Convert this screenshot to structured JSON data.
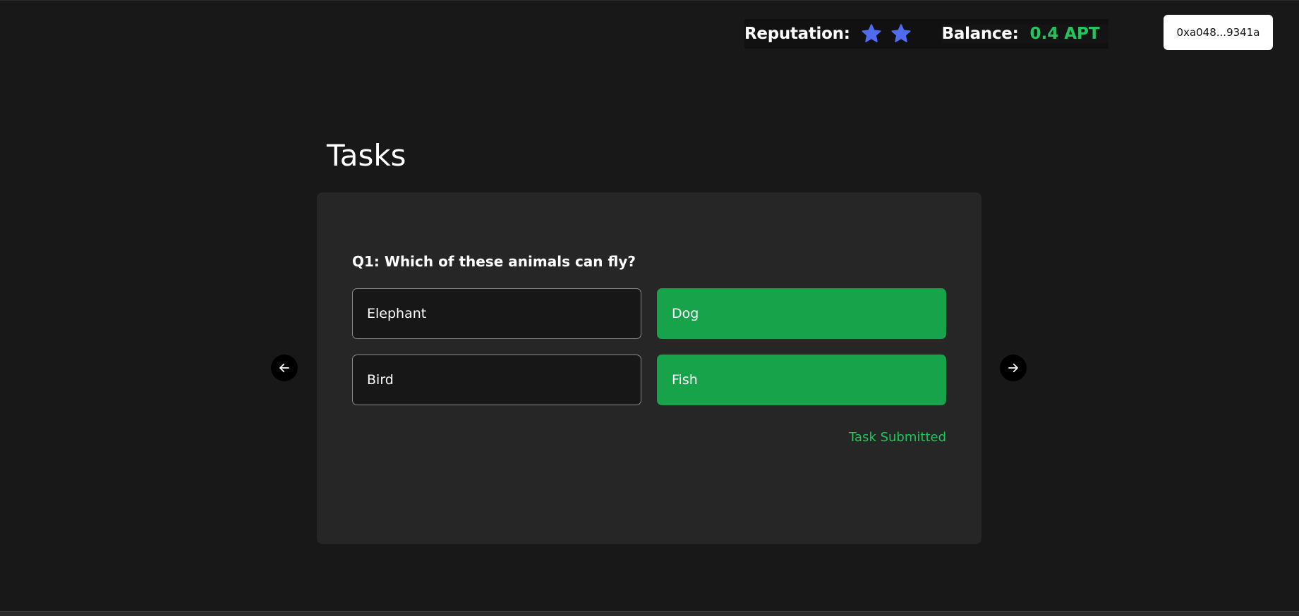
{
  "header": {
    "reputation_label": "Reputation:",
    "reputation_stars": 2,
    "star_icon": "star-icon",
    "star_color": "#4f6cf0",
    "balance_label": "Balance:",
    "balance_value": "0.4 APT",
    "balance_color": "#22c55e",
    "wallet_address": "0xa048...9341a"
  },
  "main": {
    "title": "Tasks",
    "task": {
      "question": "Q1: Which of these animals can fly?",
      "options": [
        {
          "label": "Elephant",
          "state": "default"
        },
        {
          "label": "Dog",
          "state": "highlighted"
        },
        {
          "label": "Bird",
          "state": "default"
        },
        {
          "label": "Fish",
          "state": "highlighted"
        }
      ],
      "status": "Task Submitted",
      "highlight_color": "#16a34a"
    },
    "nav": {
      "prev_icon": "arrow-left-icon",
      "next_icon": "arrow-right-icon"
    }
  }
}
